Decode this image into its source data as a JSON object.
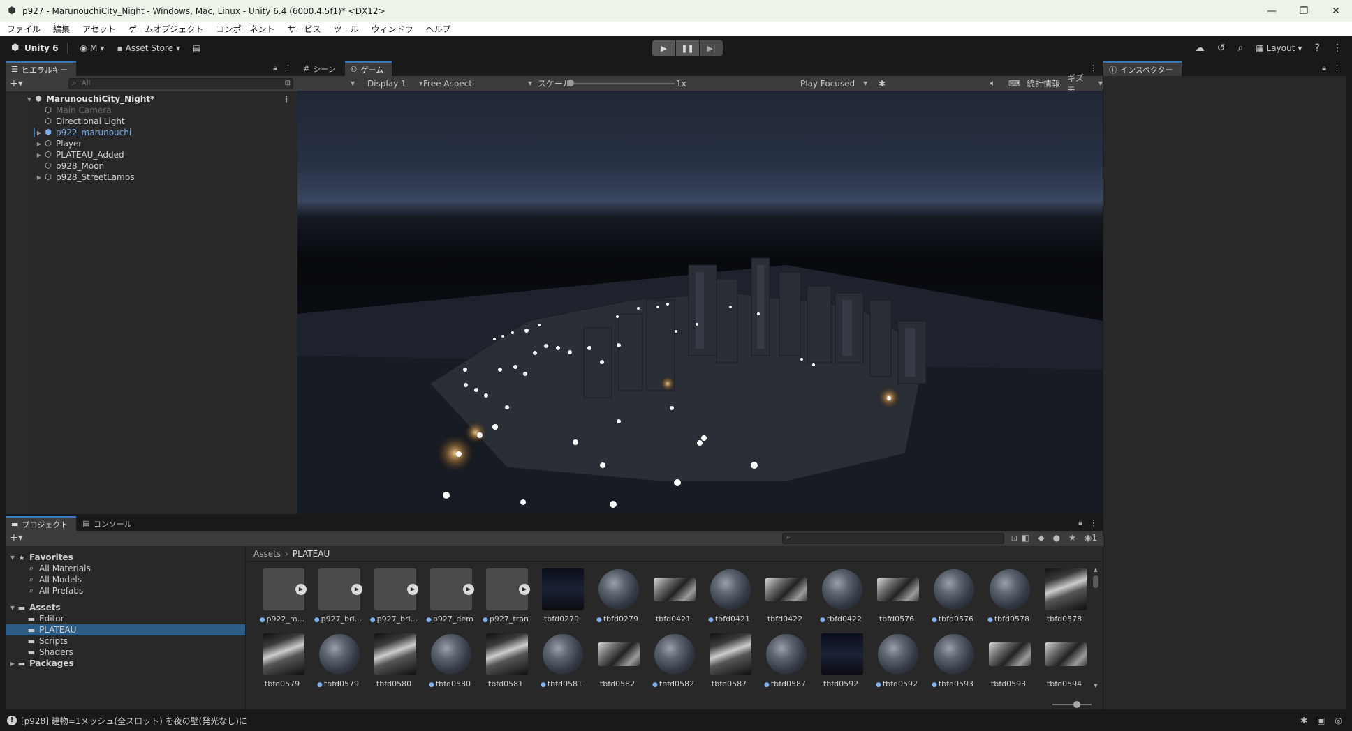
{
  "window": {
    "title": "p927 - MarunouchiCity_Night - Windows, Mac, Linux - Unity 6.4 (6000.4.5f1)* <DX12>",
    "minimize": "—",
    "maximize": "❐",
    "close": "✕"
  },
  "menu": [
    "ファイル",
    "編集",
    "アセット",
    "ゲームオブジェクト",
    "コンポーネント",
    "サービス",
    "ツール",
    "ウィンドウ",
    "ヘルプ"
  ],
  "toolbar": {
    "brand": "Unity 6",
    "account": "M",
    "asset_store": "Asset Store",
    "layout": "Layout"
  },
  "hierarchy": {
    "tab": "ヒエラルキー",
    "search_placeholder": "All",
    "scene": "MarunouchiCity_Night*",
    "items": [
      {
        "label": "Main Camera",
        "state": "dim",
        "expandable": false
      },
      {
        "label": "Directional Light",
        "state": "normal",
        "expandable": false
      },
      {
        "label": "p922_marunouchi",
        "state": "prefab",
        "expandable": true
      },
      {
        "label": "Player",
        "state": "normal",
        "expandable": true
      },
      {
        "label": "PLATEAU_Added",
        "state": "normal",
        "expandable": true
      },
      {
        "label": "p928_Moon",
        "state": "normal",
        "expandable": false
      },
      {
        "label": "p928_StreetLamps",
        "state": "normal",
        "expandable": true
      }
    ]
  },
  "game": {
    "tab_scene": "シーン",
    "tab_game": "ゲーム",
    "display": "Display 1",
    "aspect": "Free Aspect",
    "scale_label": "スケール",
    "scale_value": "1x",
    "scale_fraction": 0.0,
    "play_mode": "Play Focused",
    "stats": "統計情報",
    "gizmos": "ギズモ"
  },
  "inspector": {
    "tab": "インスペクター"
  },
  "project": {
    "tab_project": "プロジェクト",
    "tab_console": "コンソール",
    "tree": [
      {
        "label": "Favorites",
        "kind": "star",
        "level": 0,
        "bold": true
      },
      {
        "label": "All Materials",
        "kind": "search",
        "level": 1
      },
      {
        "label": "All Models",
        "kind": "search",
        "level": 1
      },
      {
        "label": "All Prefabs",
        "kind": "search",
        "level": 1
      },
      {
        "label": "Assets",
        "kind": "folder",
        "level": 0,
        "bold": true
      },
      {
        "label": "Editor",
        "kind": "folder",
        "level": 1
      },
      {
        "label": "PLATEAU",
        "kind": "folder",
        "level": 1,
        "selected": true
      },
      {
        "label": "Scripts",
        "kind": "folder",
        "level": 1
      },
      {
        "label": "Shaders",
        "kind": "folder",
        "level": 1
      },
      {
        "label": "Packages",
        "kind": "folder",
        "level": 0,
        "bold": true
      }
    ],
    "breadcrumb_root": "Assets",
    "breadcrumb_current": "PLATEAU",
    "hidden_count": "1",
    "assets": [
      {
        "label": "p922_m...",
        "kind": "model"
      },
      {
        "label": "p927_bri...",
        "kind": "model"
      },
      {
        "label": "p927_bri...",
        "kind": "model"
      },
      {
        "label": "p927_dem",
        "kind": "model"
      },
      {
        "label": "p927_tran",
        "kind": "model"
      },
      {
        "label": "tbfd0279",
        "kind": "tex-dark"
      },
      {
        "label": "tbfd0279",
        "kind": "material"
      },
      {
        "label": "tbfd0421",
        "kind": "tex"
      },
      {
        "label": "tbfd0421",
        "kind": "material"
      },
      {
        "label": "tbfd0422",
        "kind": "tex"
      },
      {
        "label": "tbfd0422",
        "kind": "material"
      },
      {
        "label": "tbfd0576",
        "kind": "tex"
      },
      {
        "label": "tbfd0576",
        "kind": "material"
      },
      {
        "label": "tbfd0578",
        "kind": "material"
      },
      {
        "label": "tbfd0578",
        "kind": "tex-tall"
      },
      {
        "label": "tbfd0579",
        "kind": "tex-tall"
      },
      {
        "label": "tbfd0579",
        "kind": "material"
      },
      {
        "label": "tbfd0580",
        "kind": "tex-tall"
      },
      {
        "label": "tbfd0580",
        "kind": "material"
      },
      {
        "label": "tbfd0581",
        "kind": "tex-tall"
      },
      {
        "label": "tbfd0581",
        "kind": "material"
      },
      {
        "label": "tbfd0582",
        "kind": "tex"
      },
      {
        "label": "tbfd0582",
        "kind": "material"
      },
      {
        "label": "tbfd0587",
        "kind": "tex-tall"
      },
      {
        "label": "tbfd0587",
        "kind": "material"
      },
      {
        "label": "tbfd0592",
        "kind": "tex-dark"
      },
      {
        "label": "tbfd0592",
        "kind": "material"
      },
      {
        "label": "tbfd0593",
        "kind": "material"
      },
      {
        "label": "tbfd0593",
        "kind": "tex"
      },
      {
        "label": "tbfd0594",
        "kind": "tex"
      }
    ]
  },
  "status": {
    "message": "[p928] 建物=1メッシュ(全スロット) を夜の壁(発光なし)に"
  },
  "colors": {
    "accent": "#3a79bb",
    "prefab_text": "#7aa7e6",
    "panel": "#282828",
    "toolbar": "#191919"
  }
}
